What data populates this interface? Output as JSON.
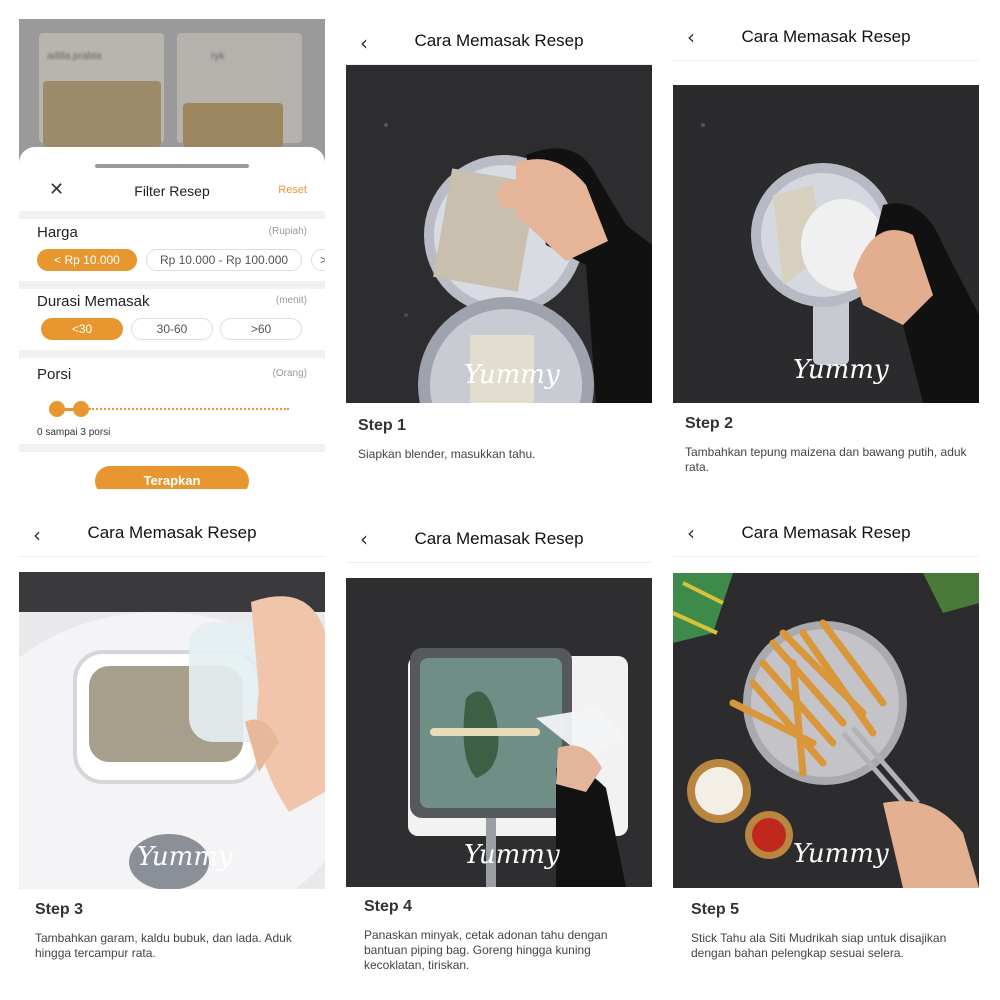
{
  "filter": {
    "background_users": [
      "adilla.prabta",
      "ryk"
    ],
    "title": "Filter Resep",
    "close_glyph": "✕",
    "reset_label": "Reset",
    "harga": {
      "label": "Harga",
      "unit": "(Rupiah)",
      "options": [
        "< Rp 10.000",
        "Rp 10.000 - Rp 100.000",
        ">"
      ],
      "selected": "< Rp 10.000"
    },
    "durasi": {
      "label": "Durasi Memasak",
      "unit": "(menit)",
      "options": [
        "<30",
        "30-60",
        ">60"
      ],
      "selected": "<30"
    },
    "porsi": {
      "label": "Porsi",
      "unit": "(Orang)",
      "range_text": "0 sampai 3 porsi"
    },
    "apply_label": "Terapkan",
    "accent": "#e8962f"
  },
  "recipe": {
    "header_title": "Cara Memasak Resep",
    "back_icon": "chevron-left-icon",
    "watermark": "Yummy",
    "steps": [
      {
        "label": "Step 1",
        "text": "Siapkan blender, masukkan tahu."
      },
      {
        "label": "Step 2",
        "text": "Tambahkan tepung maizena dan bawang putih, aduk rata."
      },
      {
        "label": "Step 3",
        "text": "Tambahkan garam, kaldu bubuk, dan lada. Aduk hingga tercampur rata."
      },
      {
        "label": "Step 4",
        "text": "Panaskan minyak, cetak adonan tahu dengan bantuan piping bag. Goreng hingga kuning kecoklatan, tiriskan."
      },
      {
        "label": "Step 5",
        "text": "Stick Tahu ala Siti Mudrikah siap untuk disajikan dengan bahan pelengkap sesuai selera."
      }
    ]
  }
}
